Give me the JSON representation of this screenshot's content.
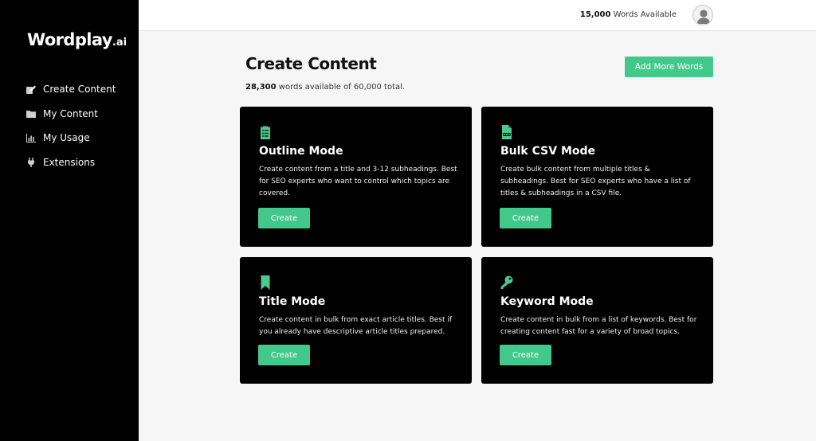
{
  "brand": {
    "name": "Wordplay",
    "suffix": ".ai"
  },
  "sidebar": {
    "items": [
      {
        "label": "Create Content",
        "icon": "edit-icon"
      },
      {
        "label": "My Content",
        "icon": "folder-icon"
      },
      {
        "label": "My Usage",
        "icon": "bar-chart-icon"
      },
      {
        "label": "Extensions",
        "icon": "plug-icon"
      }
    ]
  },
  "topbar": {
    "words_count": "15,000",
    "words_label": "Words Available"
  },
  "main": {
    "title": "Create Content",
    "available_words": "28,300",
    "available_suffix": "words available of 60,000 total.",
    "add_words_label": "Add More Words"
  },
  "cards": [
    {
      "title": "Outline Mode",
      "description": "Create content from a title and 3-12 subheadings. Best for SEO experts who want to control which topics are covered.",
      "button": "Create",
      "icon": "clipboard-list-icon"
    },
    {
      "title": "Bulk CSV Mode",
      "description": "Create bulk content from multiple titles & subheadings. Best for SEO experts who have a list of titles & subheadings in a CSV file.",
      "button": "Create",
      "icon": "csv-file-icon"
    },
    {
      "title": "Title Mode",
      "description": "Create content in bulk from exact article titles. Best if you already have descriptive article titles prepared.",
      "button": "Create",
      "icon": "bookmark-icon"
    },
    {
      "title": "Keyword Mode",
      "description": "Create content in bulk from a list of keywords. Best for creating content fast for a variety of broad topics.",
      "button": "Create",
      "icon": "key-icon"
    }
  ],
  "colors": {
    "accent": "#43c88b",
    "sidebar_bg": "#000000",
    "card_bg": "#000000",
    "page_bg": "#f6f6f6"
  }
}
